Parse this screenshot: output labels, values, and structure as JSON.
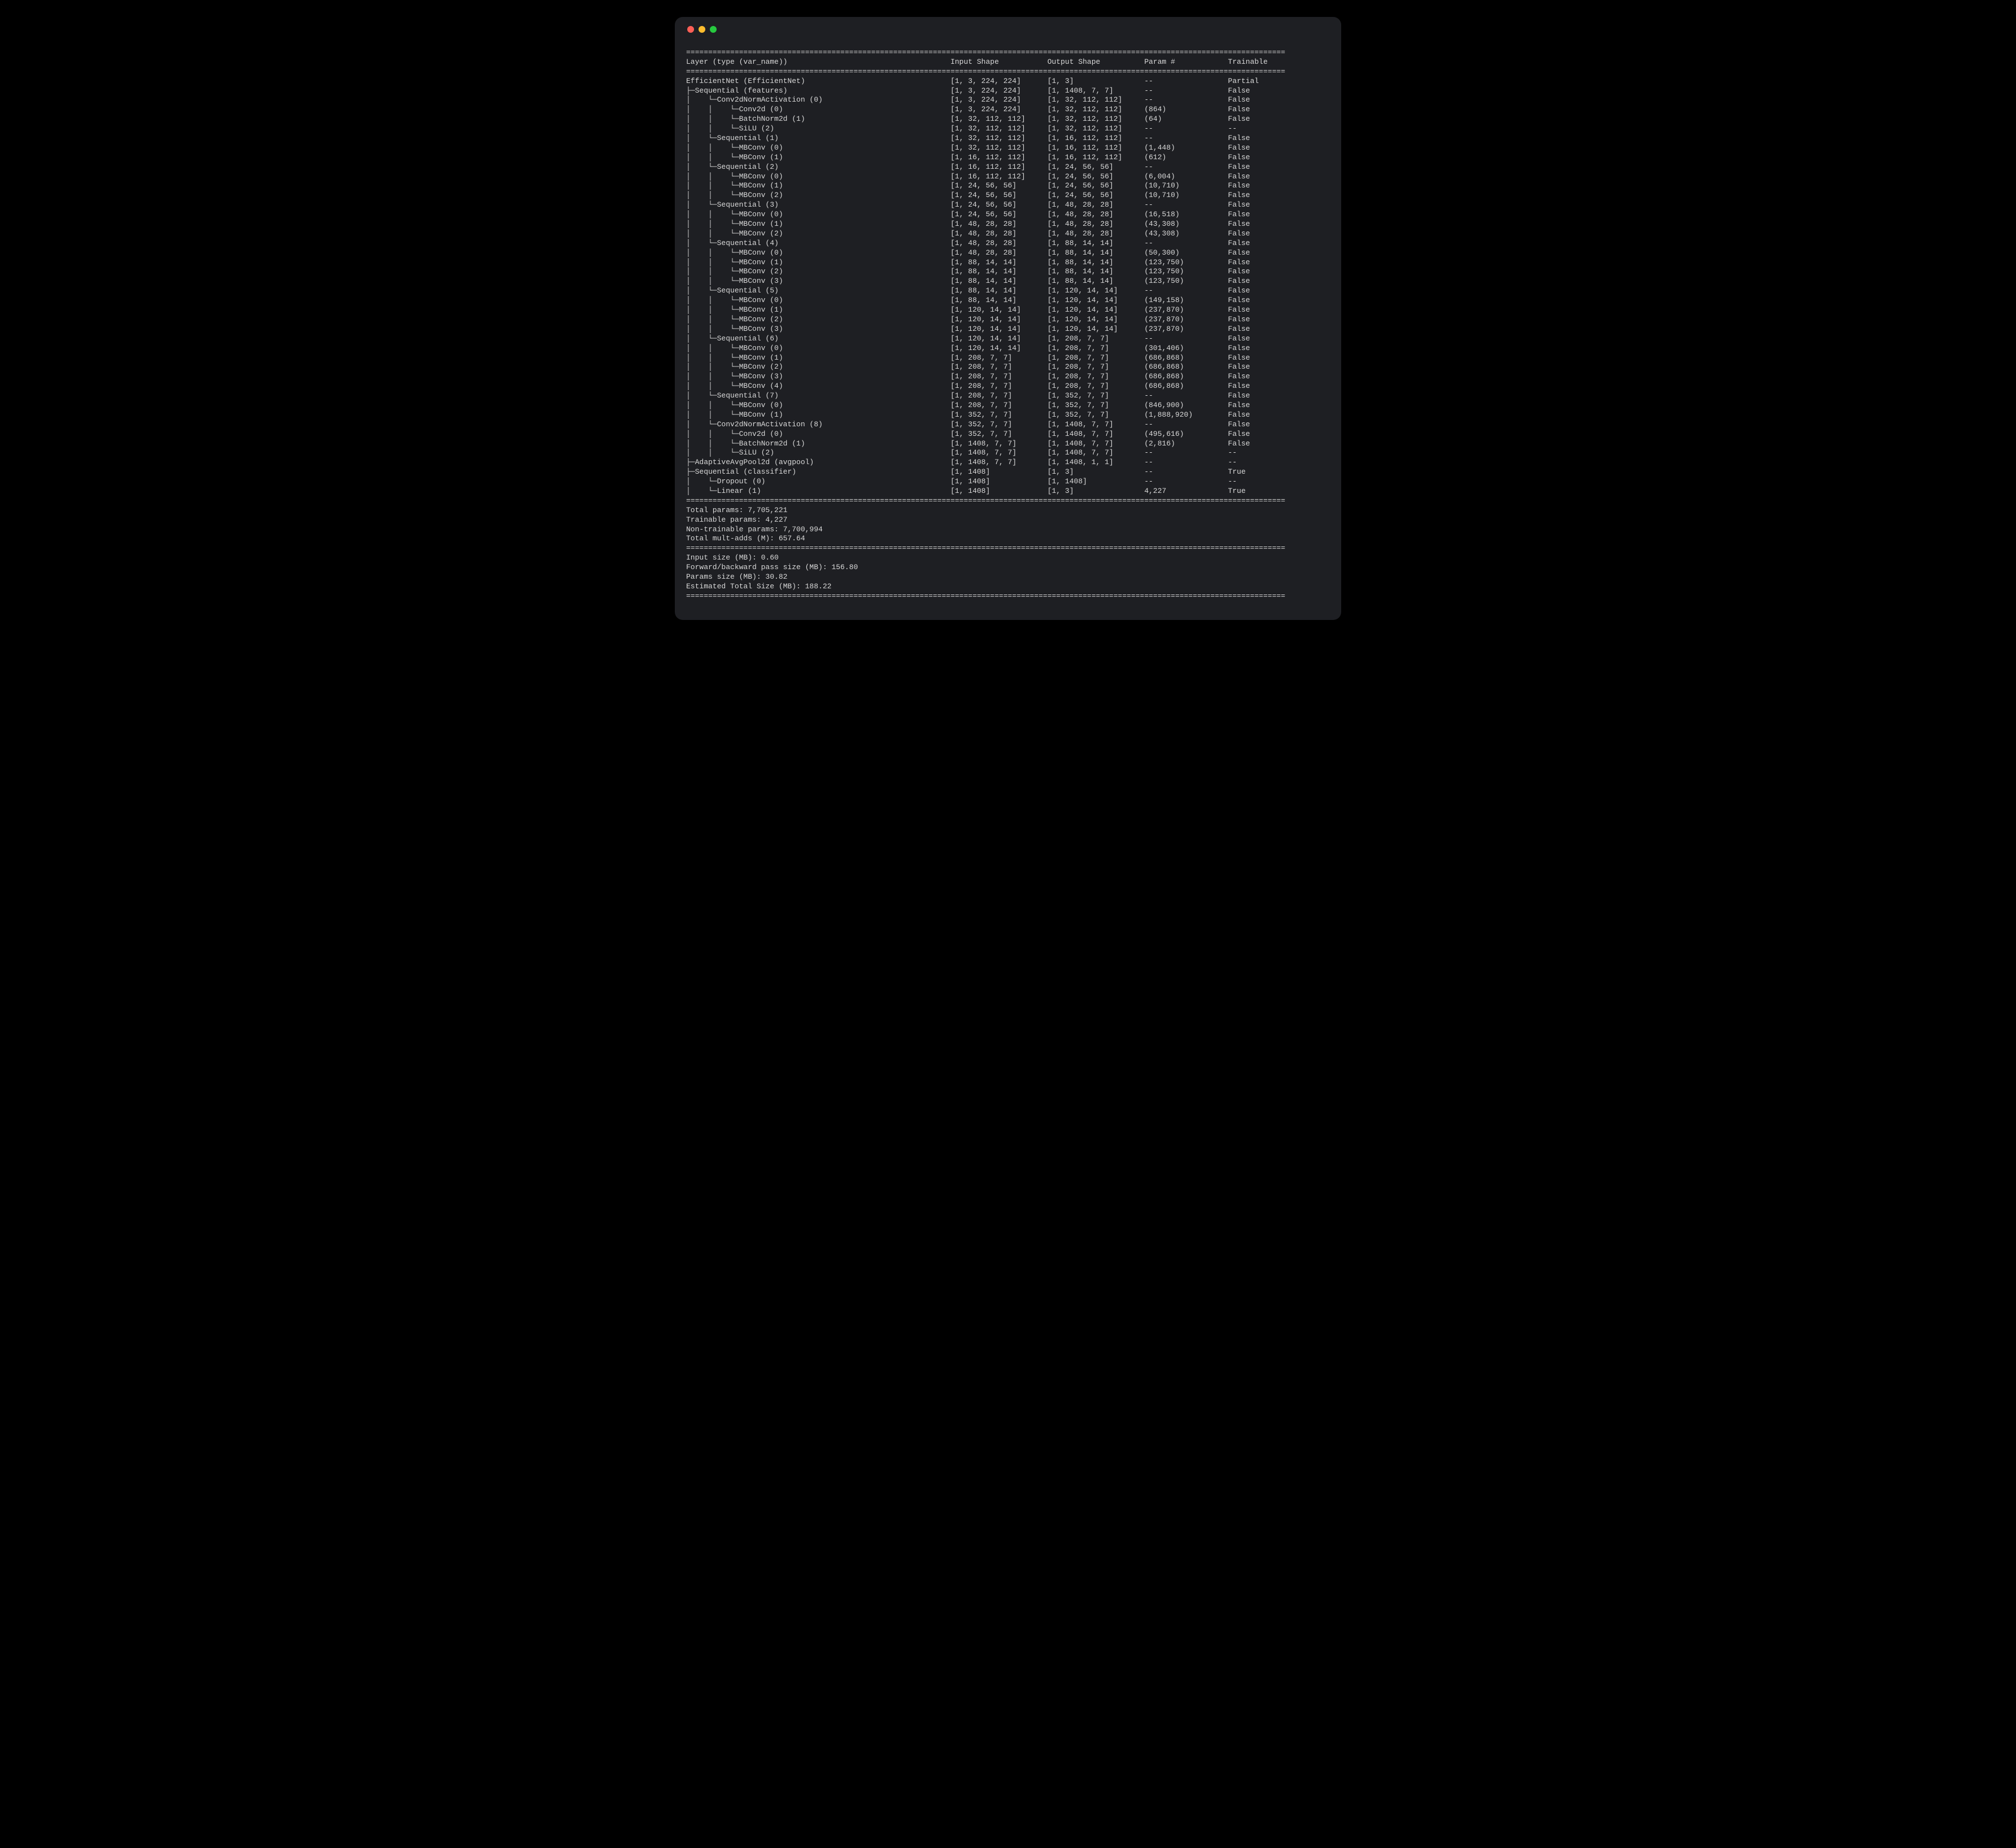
{
  "window": {
    "decorations": [
      "close",
      "minimize",
      "zoom"
    ]
  },
  "layout": {
    "total_width": 136,
    "cols": {
      "layer": 60,
      "in_shape": 22,
      "out_shape": 22,
      "params": 19,
      "trainable": 13
    }
  },
  "headers": {
    "layer": "Layer (type (var_name))",
    "in_shape": "Input Shape",
    "out_shape": "Output Shape",
    "params": "Param #",
    "trainable": "Trainable"
  },
  "tree_glyphs": {
    "tee": "├─",
    "corner": "└─",
    "pipe": "│    ",
    "pipe_narrow": "│   "
  },
  "rows": [
    {
      "indent": 0,
      "last": [],
      "label": "EfficientNet (EfficientNet)",
      "in": "[1, 3, 224, 224]",
      "out": "[1, 3]",
      "params": "--",
      "train": "Partial"
    },
    {
      "indent": 1,
      "last": [
        false
      ],
      "label": "Sequential (features)",
      "in": "[1, 3, 224, 224]",
      "out": "[1, 1408, 7, 7]",
      "params": "--",
      "train": "False"
    },
    {
      "indent": 2,
      "last": [
        false,
        true
      ],
      "label": "Conv2dNormActivation (0)",
      "in": "[1, 3, 224, 224]",
      "out": "[1, 32, 112, 112]",
      "params": "--",
      "train": "False"
    },
    {
      "indent": 3,
      "last": [
        false,
        false,
        true
      ],
      "label": "Conv2d (0)",
      "in": "[1, 3, 224, 224]",
      "out": "[1, 32, 112, 112]",
      "params": "(864)",
      "train": "False"
    },
    {
      "indent": 3,
      "last": [
        false,
        false,
        true
      ],
      "label": "BatchNorm2d (1)",
      "in": "[1, 32, 112, 112]",
      "out": "[1, 32, 112, 112]",
      "params": "(64)",
      "train": "False"
    },
    {
      "indent": 3,
      "last": [
        false,
        false,
        true
      ],
      "label": "SiLU (2)",
      "in": "[1, 32, 112, 112]",
      "out": "[1, 32, 112, 112]",
      "params": "--",
      "train": "--"
    },
    {
      "indent": 2,
      "last": [
        false,
        true
      ],
      "label": "Sequential (1)",
      "in": "[1, 32, 112, 112]",
      "out": "[1, 16, 112, 112]",
      "params": "--",
      "train": "False"
    },
    {
      "indent": 3,
      "last": [
        false,
        false,
        true
      ],
      "label": "MBConv (0)",
      "in": "[1, 32, 112, 112]",
      "out": "[1, 16, 112, 112]",
      "params": "(1,448)",
      "train": "False"
    },
    {
      "indent": 3,
      "last": [
        false,
        false,
        true
      ],
      "label": "MBConv (1)",
      "in": "[1, 16, 112, 112]",
      "out": "[1, 16, 112, 112]",
      "params": "(612)",
      "train": "False"
    },
    {
      "indent": 2,
      "last": [
        false,
        true
      ],
      "label": "Sequential (2)",
      "in": "[1, 16, 112, 112]",
      "out": "[1, 24, 56, 56]",
      "params": "--",
      "train": "False"
    },
    {
      "indent": 3,
      "last": [
        false,
        false,
        true
      ],
      "label": "MBConv (0)",
      "in": "[1, 16, 112, 112]",
      "out": "[1, 24, 56, 56]",
      "params": "(6,004)",
      "train": "False"
    },
    {
      "indent": 3,
      "last": [
        false,
        false,
        true
      ],
      "label": "MBConv (1)",
      "in": "[1, 24, 56, 56]",
      "out": "[1, 24, 56, 56]",
      "params": "(10,710)",
      "train": "False"
    },
    {
      "indent": 3,
      "last": [
        false,
        false,
        true
      ],
      "label": "MBConv (2)",
      "in": "[1, 24, 56, 56]",
      "out": "[1, 24, 56, 56]",
      "params": "(10,710)",
      "train": "False"
    },
    {
      "indent": 2,
      "last": [
        false,
        true
      ],
      "label": "Sequential (3)",
      "in": "[1, 24, 56, 56]",
      "out": "[1, 48, 28, 28]",
      "params": "--",
      "train": "False"
    },
    {
      "indent": 3,
      "last": [
        false,
        false,
        true
      ],
      "label": "MBConv (0)",
      "in": "[1, 24, 56, 56]",
      "out": "[1, 48, 28, 28]",
      "params": "(16,518)",
      "train": "False"
    },
    {
      "indent": 3,
      "last": [
        false,
        false,
        true
      ],
      "label": "MBConv (1)",
      "in": "[1, 48, 28, 28]",
      "out": "[1, 48, 28, 28]",
      "params": "(43,308)",
      "train": "False"
    },
    {
      "indent": 3,
      "last": [
        false,
        false,
        true
      ],
      "label": "MBConv (2)",
      "in": "[1, 48, 28, 28]",
      "out": "[1, 48, 28, 28]",
      "params": "(43,308)",
      "train": "False"
    },
    {
      "indent": 2,
      "last": [
        false,
        true
      ],
      "label": "Sequential (4)",
      "in": "[1, 48, 28, 28]",
      "out": "[1, 88, 14, 14]",
      "params": "--",
      "train": "False"
    },
    {
      "indent": 3,
      "last": [
        false,
        false,
        true
      ],
      "label": "MBConv (0)",
      "in": "[1, 48, 28, 28]",
      "out": "[1, 88, 14, 14]",
      "params": "(50,300)",
      "train": "False"
    },
    {
      "indent": 3,
      "last": [
        false,
        false,
        true
      ],
      "label": "MBConv (1)",
      "in": "[1, 88, 14, 14]",
      "out": "[1, 88, 14, 14]",
      "params": "(123,750)",
      "train": "False"
    },
    {
      "indent": 3,
      "last": [
        false,
        false,
        true
      ],
      "label": "MBConv (2)",
      "in": "[1, 88, 14, 14]",
      "out": "[1, 88, 14, 14]",
      "params": "(123,750)",
      "train": "False"
    },
    {
      "indent": 3,
      "last": [
        false,
        false,
        true
      ],
      "label": "MBConv (3)",
      "in": "[1, 88, 14, 14]",
      "out": "[1, 88, 14, 14]",
      "params": "(123,750)",
      "train": "False"
    },
    {
      "indent": 2,
      "last": [
        false,
        true
      ],
      "label": "Sequential (5)",
      "in": "[1, 88, 14, 14]",
      "out": "[1, 120, 14, 14]",
      "params": "--",
      "train": "False"
    },
    {
      "indent": 3,
      "last": [
        false,
        false,
        true
      ],
      "label": "MBConv (0)",
      "in": "[1, 88, 14, 14]",
      "out": "[1, 120, 14, 14]",
      "params": "(149,158)",
      "train": "False"
    },
    {
      "indent": 3,
      "last": [
        false,
        false,
        true
      ],
      "label": "MBConv (1)",
      "in": "[1, 120, 14, 14]",
      "out": "[1, 120, 14, 14]",
      "params": "(237,870)",
      "train": "False"
    },
    {
      "indent": 3,
      "last": [
        false,
        false,
        true
      ],
      "label": "MBConv (2)",
      "in": "[1, 120, 14, 14]",
      "out": "[1, 120, 14, 14]",
      "params": "(237,870)",
      "train": "False"
    },
    {
      "indent": 3,
      "last": [
        false,
        false,
        true
      ],
      "label": "MBConv (3)",
      "in": "[1, 120, 14, 14]",
      "out": "[1, 120, 14, 14]",
      "params": "(237,870)",
      "train": "False"
    },
    {
      "indent": 2,
      "last": [
        false,
        true
      ],
      "label": "Sequential (6)",
      "in": "[1, 120, 14, 14]",
      "out": "[1, 208, 7, 7]",
      "params": "--",
      "train": "False"
    },
    {
      "indent": 3,
      "last": [
        false,
        false,
        true
      ],
      "label": "MBConv (0)",
      "in": "[1, 120, 14, 14]",
      "out": "[1, 208, 7, 7]",
      "params": "(301,406)",
      "train": "False"
    },
    {
      "indent": 3,
      "last": [
        false,
        false,
        true
      ],
      "label": "MBConv (1)",
      "in": "[1, 208, 7, 7]",
      "out": "[1, 208, 7, 7]",
      "params": "(686,868)",
      "train": "False"
    },
    {
      "indent": 3,
      "last": [
        false,
        false,
        true
      ],
      "label": "MBConv (2)",
      "in": "[1, 208, 7, 7]",
      "out": "[1, 208, 7, 7]",
      "params": "(686,868)",
      "train": "False"
    },
    {
      "indent": 3,
      "last": [
        false,
        false,
        true
      ],
      "label": "MBConv (3)",
      "in": "[1, 208, 7, 7]",
      "out": "[1, 208, 7, 7]",
      "params": "(686,868)",
      "train": "False"
    },
    {
      "indent": 3,
      "last": [
        false,
        false,
        true
      ],
      "label": "MBConv (4)",
      "in": "[1, 208, 7, 7]",
      "out": "[1, 208, 7, 7]",
      "params": "(686,868)",
      "train": "False"
    },
    {
      "indent": 2,
      "last": [
        false,
        true
      ],
      "label": "Sequential (7)",
      "in": "[1, 208, 7, 7]",
      "out": "[1, 352, 7, 7]",
      "params": "--",
      "train": "False"
    },
    {
      "indent": 3,
      "last": [
        false,
        false,
        true
      ],
      "label": "MBConv (0)",
      "in": "[1, 208, 7, 7]",
      "out": "[1, 352, 7, 7]",
      "params": "(846,900)",
      "train": "False"
    },
    {
      "indent": 3,
      "last": [
        false,
        false,
        true
      ],
      "label": "MBConv (1)",
      "in": "[1, 352, 7, 7]",
      "out": "[1, 352, 7, 7]",
      "params": "(1,888,920)",
      "train": "False"
    },
    {
      "indent": 2,
      "last": [
        false,
        true
      ],
      "label": "Conv2dNormActivation (8)",
      "in": "[1, 352, 7, 7]",
      "out": "[1, 1408, 7, 7]",
      "params": "--",
      "train": "False"
    },
    {
      "indent": 3,
      "last": [
        false,
        false,
        true
      ],
      "label": "Conv2d (0)",
      "in": "[1, 352, 7, 7]",
      "out": "[1, 1408, 7, 7]",
      "params": "(495,616)",
      "train": "False"
    },
    {
      "indent": 3,
      "last": [
        false,
        false,
        true
      ],
      "label": "BatchNorm2d (1)",
      "in": "[1, 1408, 7, 7]",
      "out": "[1, 1408, 7, 7]",
      "params": "(2,816)",
      "train": "False"
    },
    {
      "indent": 3,
      "last": [
        false,
        false,
        true
      ],
      "label": "SiLU (2)",
      "in": "[1, 1408, 7, 7]",
      "out": "[1, 1408, 7, 7]",
      "params": "--",
      "train": "--"
    },
    {
      "indent": 1,
      "last": [
        false
      ],
      "label": "AdaptiveAvgPool2d (avgpool)",
      "in": "[1, 1408, 7, 7]",
      "out": "[1, 1408, 1, 1]",
      "params": "--",
      "train": "--"
    },
    {
      "indent": 1,
      "last": [
        false
      ],
      "label": "Sequential (classifier)",
      "in": "[1, 1408]",
      "out": "[1, 3]",
      "params": "--",
      "train": "True"
    },
    {
      "indent": 2,
      "last": [
        false,
        true
      ],
      "label": "Dropout (0)",
      "in": "[1, 1408]",
      "out": "[1, 1408]",
      "params": "--",
      "train": "--"
    },
    {
      "indent": 2,
      "last": [
        false,
        true
      ],
      "label": "Linear (1)",
      "in": "[1, 1408]",
      "out": "[1, 3]",
      "params": "4,227",
      "train": "True"
    }
  ],
  "summary": {
    "params": [
      "Total params: 7,705,221",
      "Trainable params: 4,227",
      "Non-trainable params: 7,700,994",
      "Total mult-adds (M): 657.64"
    ],
    "size": [
      "Input size (MB): 0.60",
      "Forward/backward pass size (MB): 156.80",
      "Params size (MB): 30.82",
      "Estimated Total Size (MB): 188.22"
    ]
  }
}
